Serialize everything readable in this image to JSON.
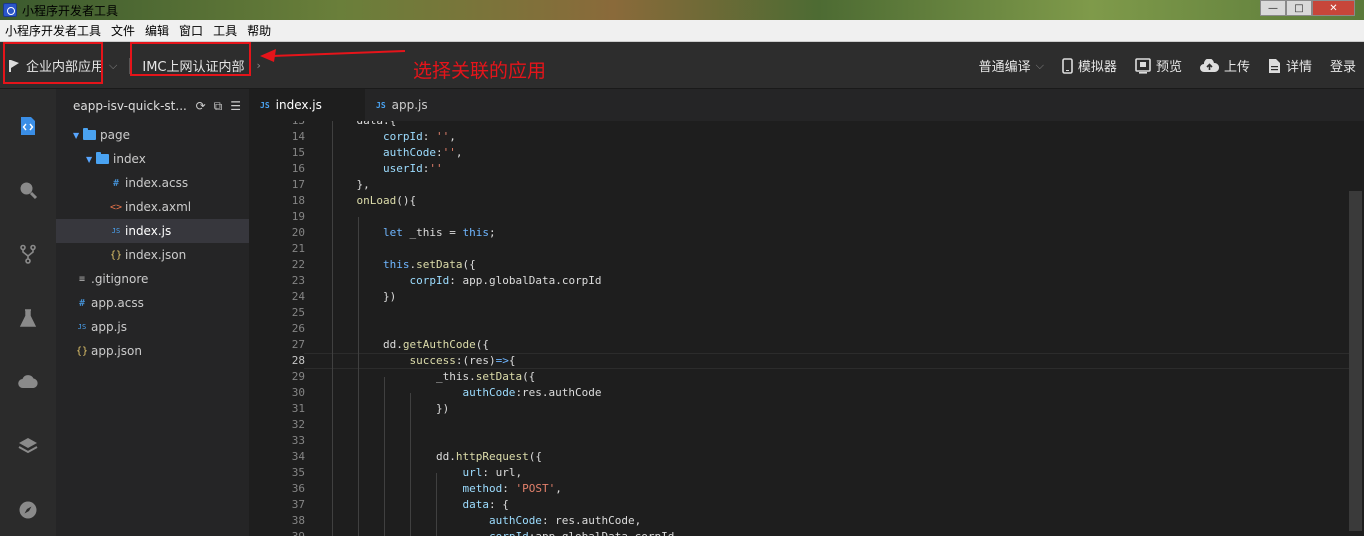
{
  "window": {
    "title": "小程序开发者工具",
    "controls": {
      "minimize": "—",
      "maximize": "□",
      "close": "✕"
    }
  },
  "menu": [
    "小程序开发者工具",
    "文件",
    "编辑",
    "窗口",
    "工具",
    "帮助"
  ],
  "toolbar": {
    "app_selector": "企业内部应用",
    "linked_app": "IMC上网认证内部",
    "annotation": "选择关联的应用",
    "compile_mode": "普通编译",
    "simulator": "模拟器",
    "preview": "预览",
    "upload": "上传",
    "details": "详情",
    "login": "登录",
    "annotation_color": "#e5141a"
  },
  "explorer": {
    "project": "eapp-isv-quick-st...",
    "tree": [
      {
        "label": "page",
        "icon": "folder",
        "depth": 0,
        "twisty": "open"
      },
      {
        "label": "index",
        "icon": "folder",
        "depth": 1,
        "twisty": "open"
      },
      {
        "label": "index.acss",
        "icon": "css",
        "depth": 2
      },
      {
        "label": "index.axml",
        "icon": "xml",
        "depth": 2
      },
      {
        "label": "index.js",
        "icon": "js",
        "depth": 2,
        "active": true
      },
      {
        "label": "index.json",
        "icon": "json",
        "depth": 2
      },
      {
        "label": ".gitignore",
        "icon": "file",
        "depth": 0
      },
      {
        "label": "app.acss",
        "icon": "css",
        "depth": 0
      },
      {
        "label": "app.js",
        "icon": "js",
        "depth": 0
      },
      {
        "label": "app.json",
        "icon": "json",
        "depth": 0
      }
    ]
  },
  "tabs": [
    {
      "label": "index.js",
      "active": true
    },
    {
      "label": "app.js",
      "active": false
    }
  ],
  "editor": {
    "current_line": 28,
    "lines": [
      {
        "n": 13,
        "text": "    data:{"
      },
      {
        "n": 14,
        "text": "        corpId: '',",
        "html": "        <span class='p'>corpId</span>: <span class='s'>''</span>,"
      },
      {
        "n": 15,
        "text": "        authCode:'',",
        "html": "        <span class='p'>authCode</span>:<span class='s'>''</span>,"
      },
      {
        "n": 16,
        "text": "        userId:''",
        "html": "        <span class='p'>userId</span>:<span class='s'>''</span>"
      },
      {
        "n": 17,
        "text": "    },"
      },
      {
        "n": 18,
        "text": "    onLoad(){",
        "html": "    <span class='f'>onLoad</span>(){"
      },
      {
        "n": 19,
        "text": ""
      },
      {
        "n": 20,
        "text": "        let _this = this;",
        "html": "        <span class='k'>let</span> _this = <span class='k'>this</span>;"
      },
      {
        "n": 21,
        "text": ""
      },
      {
        "n": 22,
        "text": "        this.setData({",
        "html": "        <span class='k'>this</span>.<span class='f'>setData</span>({"
      },
      {
        "n": 23,
        "text": "            corpId: app.globalData.corpId",
        "html": "            <span class='p'>corpId</span>: app.globalData.corpId"
      },
      {
        "n": 24,
        "text": "        })"
      },
      {
        "n": 25,
        "text": ""
      },
      {
        "n": 26,
        "text": ""
      },
      {
        "n": 27,
        "text": "        dd.getAuthCode({",
        "html": "        dd.<span class='f'>getAuthCode</span>({"
      },
      {
        "n": 28,
        "text": "            success:(res)=>{",
        "html": "            <span class='f'>success</span>:(res)<span class='k'>=></span>{"
      },
      {
        "n": 29,
        "text": "                _this.setData({",
        "html": "                _this.<span class='f'>setData</span>({"
      },
      {
        "n": 30,
        "text": "                    authCode:res.authCode",
        "html": "                    <span class='p'>authCode</span>:res.authCode"
      },
      {
        "n": 31,
        "text": "                })"
      },
      {
        "n": 32,
        "text": ""
      },
      {
        "n": 33,
        "text": ""
      },
      {
        "n": 34,
        "text": "                dd.httpRequest({",
        "html": "                dd.<span class='f'>httpRequest</span>({"
      },
      {
        "n": 35,
        "text": "                    url: url,",
        "html": "                    <span class='p'>url</span>: url,"
      },
      {
        "n": 36,
        "text": "                    method: 'POST',",
        "html": "                    <span class='p'>method</span>: <span class='s'>'POST'</span>,"
      },
      {
        "n": 37,
        "text": "                    data: {",
        "html": "                    <span class='p'>data</span>: {"
      },
      {
        "n": 38,
        "text": "                        authCode: res.authCode,",
        "html": "                        <span class='p'>authCode</span>: res.authCode,"
      },
      {
        "n": 39,
        "text": "                        corpId:app.globalData.corpId",
        "html": "                        <span class='p'>corpId</span>:app.globalData.corpId"
      }
    ]
  },
  "icons": {
    "activity": [
      "code-file-icon",
      "search-icon",
      "branch-icon",
      "flask-icon",
      "cloud-icon",
      "layers-icon",
      "compass-icon"
    ]
  }
}
